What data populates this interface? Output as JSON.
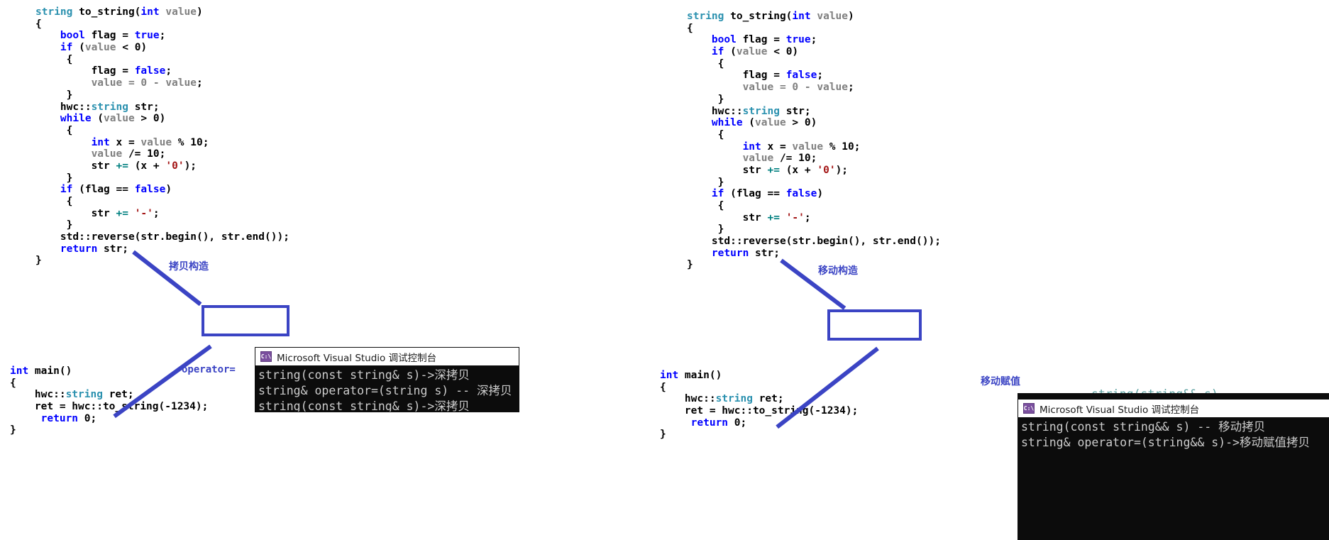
{
  "meta": {
    "accent_blue": "#3b44c4",
    "keyword_blue": "#0000ff",
    "type_teal": "#2b91af",
    "string_red": "#a31515",
    "console_bg": "#0c0c0c",
    "console_fg": "#cccccc"
  },
  "left_panel": {
    "code_lines": [
      [
        {
          "t": "string ",
          "c": "type"
        },
        {
          "t": "to_string(",
          "c": "plain"
        },
        {
          "t": "int",
          "c": "kw"
        },
        {
          "t": " value",
          "c": "var"
        },
        {
          "t": ")",
          "c": "plain"
        }
      ],
      [
        {
          "t": "{",
          "c": "plain"
        }
      ],
      [
        {
          "t": "    bool",
          "c": "kw"
        },
        {
          "t": " flag = ",
          "c": "plain"
        },
        {
          "t": "true",
          "c": "kw"
        },
        {
          "t": ";",
          "c": "plain"
        }
      ],
      [
        {
          "t": "    if",
          "c": "kw"
        },
        {
          "t": " (",
          "c": "plain"
        },
        {
          "t": "value",
          "c": "var"
        },
        {
          "t": " < 0)",
          "c": "plain"
        }
      ],
      [
        {
          "t": "     {",
          "c": "plain"
        }
      ],
      [
        {
          "t": "         flag = ",
          "c": "plain"
        },
        {
          "t": "false",
          "c": "kw"
        },
        {
          "t": ";",
          "c": "plain"
        }
      ],
      [
        {
          "t": "         value = 0 - value",
          "c": "var"
        },
        {
          "t": ";",
          "c": "plain"
        }
      ],
      [
        {
          "t": "     }",
          "c": "plain"
        }
      ],
      [
        {
          "t": "    hwc::",
          "c": "plain"
        },
        {
          "t": "string",
          "c": "type"
        },
        {
          "t": " str;",
          "c": "plain"
        }
      ],
      [
        {
          "t": "    while",
          "c": "kw"
        },
        {
          "t": " (",
          "c": "plain"
        },
        {
          "t": "value",
          "c": "var"
        },
        {
          "t": " > 0)",
          "c": "plain"
        }
      ],
      [
        {
          "t": "     {",
          "c": "plain"
        }
      ],
      [
        {
          "t": "         int",
          "c": "kw"
        },
        {
          "t": " x = ",
          "c": "plain"
        },
        {
          "t": "value",
          "c": "var"
        },
        {
          "t": " % 10;",
          "c": "plain"
        }
      ],
      [
        {
          "t": "         value",
          "c": "var"
        },
        {
          "t": " /= 10;",
          "c": "plain"
        }
      ],
      [
        {
          "t": "         str ",
          "c": "plain"
        },
        {
          "t": "+=",
          "c": "op"
        },
        {
          "t": " (x + ",
          "c": "plain"
        },
        {
          "t": "'0'",
          "c": "str"
        },
        {
          "t": ");",
          "c": "plain"
        }
      ],
      [
        {
          "t": "     }",
          "c": "plain"
        }
      ],
      [
        {
          "t": "    if",
          "c": "kw"
        },
        {
          "t": " (flag == ",
          "c": "plain"
        },
        {
          "t": "false",
          "c": "kw"
        },
        {
          "t": ")",
          "c": "plain"
        }
      ],
      [
        {
          "t": "     {",
          "c": "plain"
        }
      ],
      [
        {
          "t": "         str ",
          "c": "plain"
        },
        {
          "t": "+=",
          "c": "op"
        },
        {
          "t": " ",
          "c": "plain"
        },
        {
          "t": "'-'",
          "c": "str"
        },
        {
          "t": ";",
          "c": "plain"
        }
      ],
      [
        {
          "t": "     }",
          "c": "plain"
        }
      ],
      [
        {
          "t": "    std::reverse(str.begin(), str.end());",
          "c": "plain"
        }
      ],
      [
        {
          "t": "    return",
          "c": "kw"
        },
        {
          "t": " str;",
          "c": "plain"
        }
      ],
      [
        {
          "t": "}",
          "c": "plain"
        }
      ]
    ],
    "main_lines": [
      [
        {
          "t": "int",
          "c": "kw"
        },
        {
          "t": " main()",
          "c": "plain"
        }
      ],
      [
        {
          "t": "{",
          "c": "plain"
        }
      ],
      [
        {
          "t": "    hwc::",
          "c": "plain"
        },
        {
          "t": "string",
          "c": "type"
        },
        {
          "t": " ret;",
          "c": "plain"
        }
      ],
      [
        {
          "t": "    ret = hwc::to_string(-1234);",
          "c": "plain"
        }
      ],
      [
        {
          "t": "     return",
          "c": "kw"
        },
        {
          "t": " 0;",
          "c": "plain"
        }
      ],
      [
        {
          "t": "}",
          "c": "plain"
        }
      ]
    ],
    "annotations": {
      "copy_ctor": "拷贝构造",
      "operator_assign": "operator="
    },
    "console": {
      "title": "Microsoft Visual Studio 调试控制台",
      "icon": "cmd-prompt-icon",
      "icon_glyph": "C:\\",
      "lines": [
        "string(const string& s)->深拷贝",
        "string& operator=(string s) -- 深拷贝",
        "string(const string& s)->深拷贝"
      ]
    }
  },
  "right_panel": {
    "code_lines": [
      [
        {
          "t": "string ",
          "c": "type"
        },
        {
          "t": "to_string(",
          "c": "plain"
        },
        {
          "t": "int",
          "c": "kw"
        },
        {
          "t": " value",
          "c": "var"
        },
        {
          "t": ")",
          "c": "plain"
        }
      ],
      [
        {
          "t": "{",
          "c": "plain"
        }
      ],
      [
        {
          "t": "    bool",
          "c": "kw"
        },
        {
          "t": " flag = ",
          "c": "plain"
        },
        {
          "t": "true",
          "c": "kw"
        },
        {
          "t": ";",
          "c": "plain"
        }
      ],
      [
        {
          "t": "    if",
          "c": "kw"
        },
        {
          "t": " (",
          "c": "plain"
        },
        {
          "t": "value",
          "c": "var"
        },
        {
          "t": " < 0)",
          "c": "plain"
        }
      ],
      [
        {
          "t": "     {",
          "c": "plain"
        }
      ],
      [
        {
          "t": "         flag = ",
          "c": "plain"
        },
        {
          "t": "false",
          "c": "kw"
        },
        {
          "t": ";",
          "c": "plain"
        }
      ],
      [
        {
          "t": "         value = 0 - value",
          "c": "var"
        },
        {
          "t": ";",
          "c": "plain"
        }
      ],
      [
        {
          "t": "     }",
          "c": "plain"
        }
      ],
      [
        {
          "t": "    hwc::",
          "c": "plain"
        },
        {
          "t": "string",
          "c": "type"
        },
        {
          "t": " str;",
          "c": "plain"
        }
      ],
      [
        {
          "t": "    while",
          "c": "kw"
        },
        {
          "t": " (",
          "c": "plain"
        },
        {
          "t": "value",
          "c": "var"
        },
        {
          "t": " > 0)",
          "c": "plain"
        }
      ],
      [
        {
          "t": "     {",
          "c": "plain"
        }
      ],
      [
        {
          "t": "         int",
          "c": "kw"
        },
        {
          "t": " x = ",
          "c": "plain"
        },
        {
          "t": "value",
          "c": "var"
        },
        {
          "t": " % 10;",
          "c": "plain"
        }
      ],
      [
        {
          "t": "         value",
          "c": "var"
        },
        {
          "t": " /= 10;",
          "c": "plain"
        }
      ],
      [
        {
          "t": "         str ",
          "c": "plain"
        },
        {
          "t": "+=",
          "c": "op"
        },
        {
          "t": " (x + ",
          "c": "plain"
        },
        {
          "t": "'0'",
          "c": "str"
        },
        {
          "t": ");",
          "c": "plain"
        }
      ],
      [
        {
          "t": "     }",
          "c": "plain"
        }
      ],
      [
        {
          "t": "    if",
          "c": "kw"
        },
        {
          "t": " (flag == ",
          "c": "plain"
        },
        {
          "t": "false",
          "c": "kw"
        },
        {
          "t": ")",
          "c": "plain"
        }
      ],
      [
        {
          "t": "     {",
          "c": "plain"
        }
      ],
      [
        {
          "t": "         str ",
          "c": "plain"
        },
        {
          "t": "+=",
          "c": "op"
        },
        {
          "t": " ",
          "c": "plain"
        },
        {
          "t": "'-'",
          "c": "str"
        },
        {
          "t": ";",
          "c": "plain"
        }
      ],
      [
        {
          "t": "     }",
          "c": "plain"
        }
      ],
      [
        {
          "t": "    std::reverse(str.begin(), str.end());",
          "c": "plain"
        }
      ],
      [
        {
          "t": "    return",
          "c": "kw"
        },
        {
          "t": " str;",
          "c": "plain"
        }
      ],
      [
        {
          "t": "}",
          "c": "plain"
        }
      ]
    ],
    "main_lines": [
      [
        {
          "t": "int",
          "c": "kw"
        },
        {
          "t": " main()",
          "c": "plain"
        }
      ],
      [
        {
          "t": "{",
          "c": "plain"
        }
      ],
      [
        {
          "t": "    hwc::",
          "c": "plain"
        },
        {
          "t": "string",
          "c": "type"
        },
        {
          "t": " ret;",
          "c": "plain"
        }
      ],
      [
        {
          "t": "    ret = hwc::to_string(-1234);",
          "c": "plain"
        }
      ],
      [
        {
          "t": "     return",
          "c": "kw"
        },
        {
          "t": " 0;",
          "c": "plain"
        }
      ],
      [
        {
          "t": "}",
          "c": "plain"
        }
      ]
    ],
    "annotations": {
      "move_ctor": "移动构造",
      "move_assign": "移动赋值"
    },
    "console": {
      "title": "Microsoft Visual Studio 调试控制台",
      "icon": "cmd-prompt-icon",
      "icon_glyph": "C:\\",
      "ghost_line": "string(string&& s)",
      "lines": [
        "string(const string&& s) -- 移动拷贝",
        "string& operator=(string&& s)->移动赋值拷贝"
      ]
    }
  }
}
